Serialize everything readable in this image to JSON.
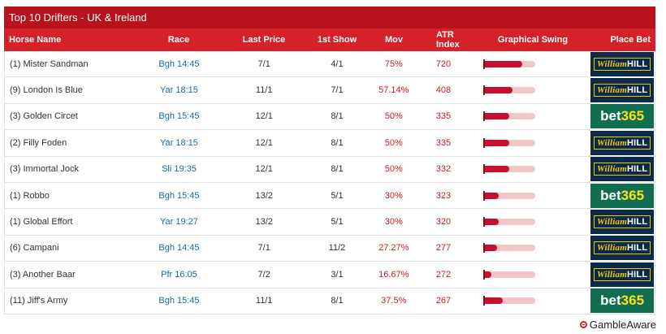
{
  "title": "Top 10 Drifters - UK & Ireland",
  "headers": {
    "horse": "Horse Name",
    "race": "Race",
    "last_price": "Last Price",
    "first_show": "1st Show",
    "mov": "Mov",
    "atr": "ATR Index",
    "swing": "Graphical Swing",
    "bet": "Place Bet"
  },
  "bookmakers": {
    "williamhill": {
      "script": "William",
      "block": "HILL"
    },
    "bet365": {
      "a": "bet",
      "b": "365"
    }
  },
  "rows": [
    {
      "horse": "(1) Mister Sandman",
      "race": "Bgh 14:45",
      "last": "7/1",
      "show": "4/1",
      "mov": "75%",
      "atr": "720",
      "swing": 0.75,
      "bookie": "williamhill"
    },
    {
      "horse": "(9) London Is Blue",
      "race": "Yar 18:15",
      "last": "11/1",
      "show": "7/1",
      "mov": "57.14%",
      "atr": "408",
      "swing": 0.5714,
      "bookie": "williamhill"
    },
    {
      "horse": "(3) Golden Circet",
      "race": "Bgh 15:45",
      "last": "12/1",
      "show": "8/1",
      "mov": "50%",
      "atr": "335",
      "swing": 0.5,
      "bookie": "bet365"
    },
    {
      "horse": "(2) Filly Foden",
      "race": "Yar 18:15",
      "last": "12/1",
      "show": "8/1",
      "mov": "50%",
      "atr": "335",
      "swing": 0.5,
      "bookie": "williamhill"
    },
    {
      "horse": "(3) Immortal Jock",
      "race": "Sli 19:35",
      "last": "12/1",
      "show": "8/1",
      "mov": "50%",
      "atr": "332",
      "swing": 0.5,
      "bookie": "williamhill"
    },
    {
      "horse": "(1) Robbo",
      "race": "Bgh 15:45",
      "last": "13/2",
      "show": "5/1",
      "mov": "30%",
      "atr": "323",
      "swing": 0.3,
      "bookie": "bet365"
    },
    {
      "horse": "(1) Global Effort",
      "race": "Yar 19:27",
      "last": "13/2",
      "show": "5/1",
      "mov": "30%",
      "atr": "320",
      "swing": 0.3,
      "bookie": "williamhill"
    },
    {
      "horse": "(6) Campani",
      "race": "Bgh 14:45",
      "last": "7/1",
      "show": "11/2",
      "mov": "27.27%",
      "atr": "277",
      "swing": 0.2727,
      "bookie": "williamhill"
    },
    {
      "horse": "(3) Another Baar",
      "race": "Pfr 16:05",
      "last": "7/2",
      "show": "3/1",
      "mov": "16.67%",
      "atr": "272",
      "swing": 0.1667,
      "bookie": "williamhill"
    },
    {
      "horse": "(11) Jiff's Army",
      "race": "Bgh 15:45",
      "last": "11/1",
      "show": "8/1",
      "mov": "37.5%",
      "atr": "267",
      "swing": 0.375,
      "bookie": "bet365"
    }
  ],
  "footer": {
    "gamble_aware": "GambleAware"
  },
  "colors": {
    "title_bg": "#b8131d",
    "header_bg": "#d4212a",
    "race_link": "#1a6aa1",
    "mov_text": "#c81e28"
  }
}
